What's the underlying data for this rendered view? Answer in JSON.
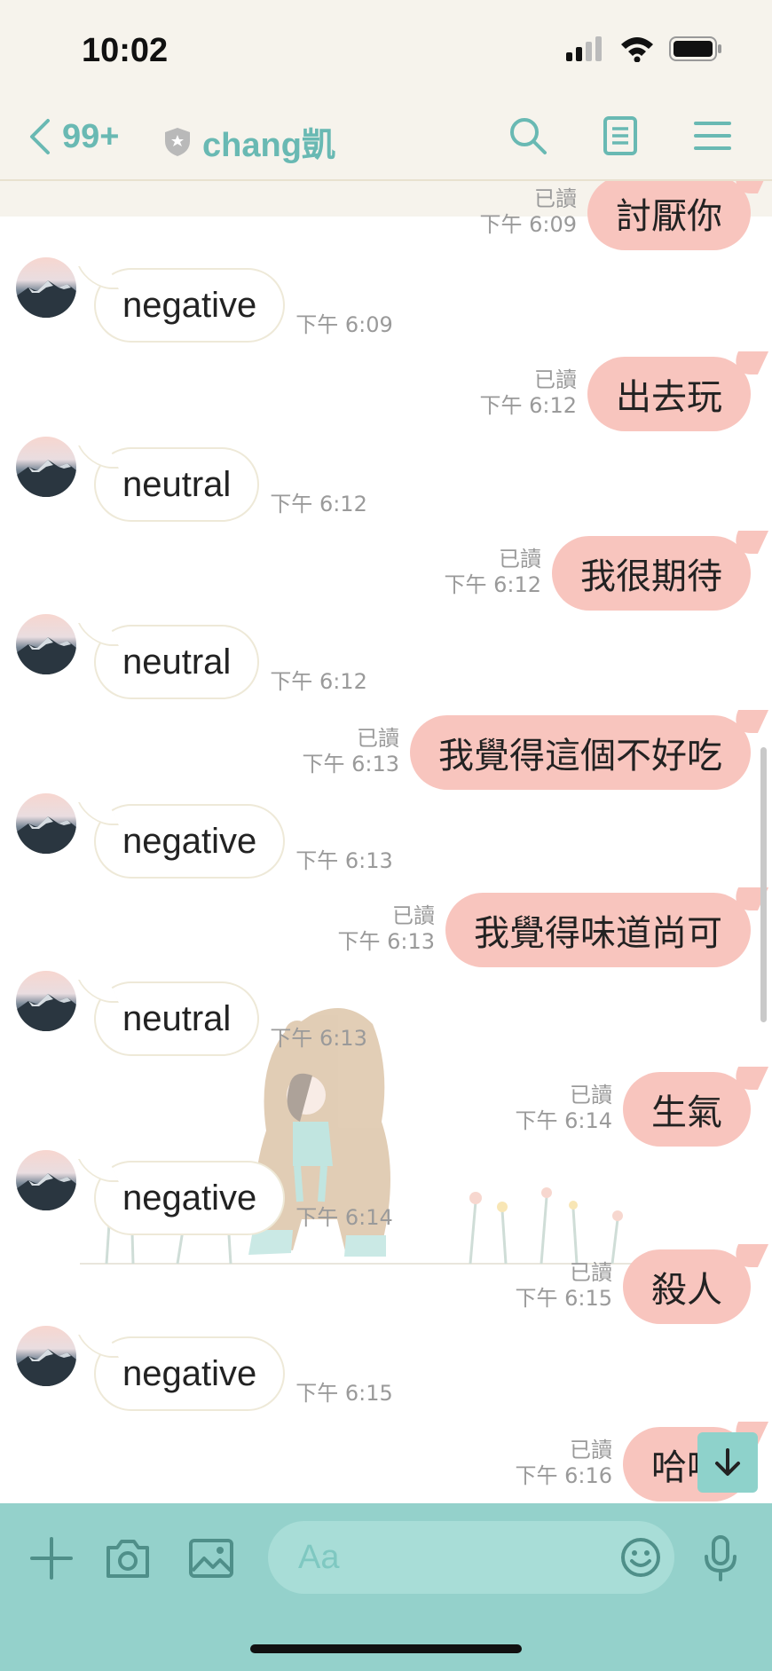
{
  "status_bar": {
    "time": "10:02"
  },
  "nav": {
    "back_count": "99+",
    "title": "chang凱"
  },
  "messages": [
    {
      "side": "out",
      "text": "討厭你",
      "read": "已讀",
      "time": "下午 6:09"
    },
    {
      "side": "in",
      "text": "negative",
      "time": "下午 6:09"
    },
    {
      "side": "out",
      "text": "出去玩",
      "read": "已讀",
      "time": "下午 6:12"
    },
    {
      "side": "in",
      "text": "neutral",
      "time": "下午 6:12"
    },
    {
      "side": "out",
      "text": "我很期待",
      "read": "已讀",
      "time": "下午 6:12"
    },
    {
      "side": "in",
      "text": "neutral",
      "time": "下午 6:12"
    },
    {
      "side": "out",
      "text": "我覺得這個不好吃",
      "read": "已讀",
      "time": "下午 6:13"
    },
    {
      "side": "in",
      "text": "negative",
      "time": "下午 6:13"
    },
    {
      "side": "out",
      "text": "我覺得味道尚可",
      "read": "已讀",
      "time": "下午 6:13"
    },
    {
      "side": "in",
      "text": "neutral",
      "time": "下午 6:13"
    },
    {
      "side": "out",
      "text": "生氣",
      "read": "已讀",
      "time": "下午 6:14"
    },
    {
      "side": "in",
      "text": "negative",
      "time": "下午 6:14"
    },
    {
      "side": "out",
      "text": "殺人",
      "read": "已讀",
      "time": "下午 6:15"
    },
    {
      "side": "in",
      "text": "negative",
      "time": "下午 6:15"
    },
    {
      "side": "out",
      "text": "哈嘍",
      "read": "已讀",
      "time": "下午 6:16"
    }
  ],
  "input": {
    "placeholder": "Aa"
  },
  "colors": {
    "accent": "#69b9b3",
    "outgoing_bubble": "#f8c5be",
    "input_bar": "#94d1cb",
    "header_bg": "#f6f3ec"
  },
  "icons": [
    "signal-icon",
    "wifi-icon",
    "battery-icon",
    "back-chevron-icon",
    "shield-icon",
    "search-icon",
    "notes-icon",
    "menu-icon",
    "plus-icon",
    "camera-icon",
    "image-icon",
    "emoji-icon",
    "mic-icon",
    "arrow-down-icon"
  ]
}
